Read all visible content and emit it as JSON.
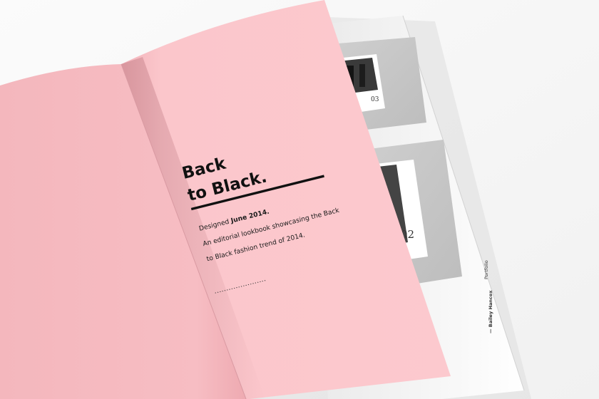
{
  "book": {
    "page_color": "#f9c3c8",
    "title_line1": "Back",
    "title_line2": "to Black.",
    "designed_prefix": "Designed ",
    "designed_date": "June 2014.",
    "desc_line1": "An editorial lookbook showcasing the Back",
    "desc_line2": "to Black fashion trend of 2014."
  },
  "underlay": {
    "photo_number_top": "03",
    "photo_number_bottom": "02",
    "spine_author": "— Bailey Hancox",
    "spine_section": "Portfolio"
  }
}
